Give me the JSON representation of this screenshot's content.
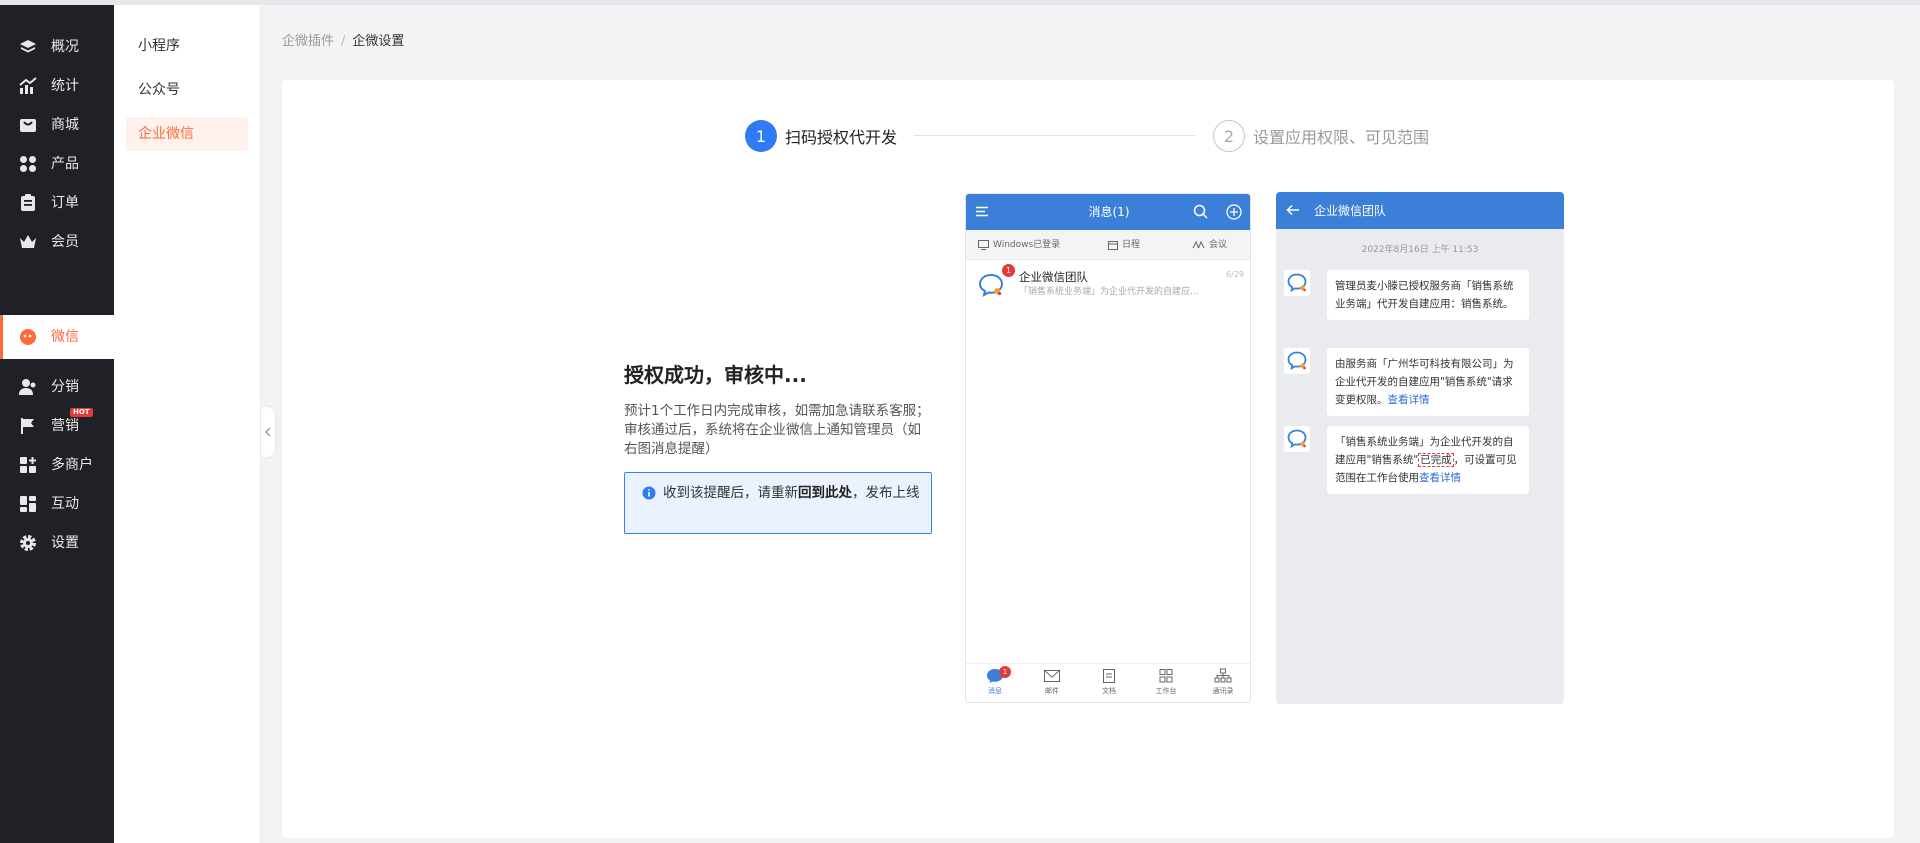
{
  "sidebar": {
    "items": [
      {
        "label": "概况",
        "icon": "layers-icon"
      },
      {
        "label": "统计",
        "icon": "chart-icon"
      },
      {
        "label": "商城",
        "icon": "shop-icon"
      },
      {
        "label": "产品",
        "icon": "product-icon"
      },
      {
        "label": "订单",
        "icon": "order-icon"
      },
      {
        "label": "会员",
        "icon": "crown-icon"
      },
      {
        "label": "微信",
        "icon": "wechat-icon",
        "active": true
      },
      {
        "label": "分销",
        "icon": "distribution-icon"
      },
      {
        "label": "营销",
        "icon": "flag-icon",
        "badge": "HOT"
      },
      {
        "label": "多商户",
        "icon": "merchant-icon"
      },
      {
        "label": "互动",
        "icon": "interact-icon"
      },
      {
        "label": "设置",
        "icon": "settings-icon"
      }
    ]
  },
  "submenu": {
    "items": [
      {
        "label": "小程序"
      },
      {
        "label": "公众号"
      },
      {
        "label": "企业微信",
        "active": true
      }
    ]
  },
  "breadcrumb": {
    "parent": "企微插件",
    "separator": "/",
    "current": "企微设置"
  },
  "steps": [
    {
      "number": "1",
      "title": "扫码授权代开发",
      "active": true
    },
    {
      "number": "2",
      "title": "设置应用权限、可见范围",
      "active": false
    }
  ],
  "info": {
    "title": "授权成功，审核中...",
    "description": "预计1个工作日内完成审核，如需加急请联系客服；审核通过后，系统将在企业微信上通知管理员（如右图消息提醒）",
    "notice_before": "收到该提醒后，请重新",
    "notice_bold": "回到此处",
    "notice_after": "，发布上线"
  },
  "phone1": {
    "header_title": "消息(1)",
    "tabs": [
      "Windows已登录",
      "日程",
      "会议"
    ],
    "message": {
      "name": "企业微信团队",
      "time": "6/29",
      "badge": "1",
      "preview": "「销售系统业务端」为企业代开发的自建应..."
    },
    "bottom_nav": [
      {
        "label": "消息",
        "badge": "1"
      },
      {
        "label": "邮件"
      },
      {
        "label": "文档"
      },
      {
        "label": "工作台"
      },
      {
        "label": "通讯录"
      }
    ]
  },
  "phone2": {
    "header_title": "企业微信团队",
    "date": "2022年8月16日  上午 11:53",
    "messages": [
      {
        "text": "管理员麦小滕已授权服务商「销售系统业务端」代开发自建应用：销售系统。"
      },
      {
        "text": "由服务商「广州华可科技有限公司」为企业代开发的自建应用\"销售系统\"请求变更权限。",
        "link": "查看详情"
      },
      {
        "text_before": "「销售系统业务端」为企业代开发的自建应用\"销售系统\"",
        "highlight": "已完成",
        "text_after": "，可设置可见范围在工作台使用",
        "link": "查看详情"
      }
    ]
  },
  "colors": {
    "accent": "#ff6a3d",
    "primary": "#2f7bf5",
    "phone_header": "#3b7fd8",
    "sidebar_bg": "#1f2126"
  }
}
